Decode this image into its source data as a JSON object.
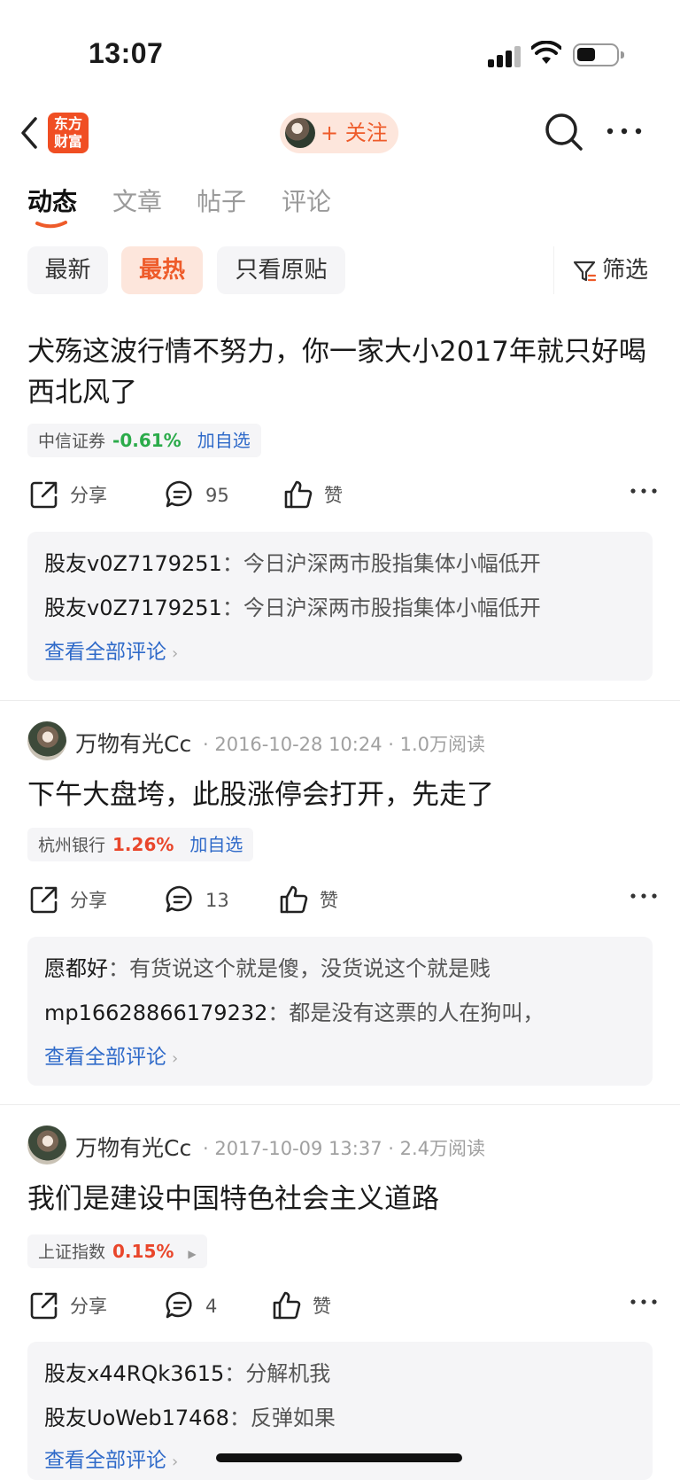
{
  "status_bar": {
    "time": "13:07"
  },
  "nav": {
    "logo_line1": "东方",
    "logo_line2": "财富",
    "follow_label": "+ 关注"
  },
  "tabs": [
    {
      "label": "动态",
      "active": true
    },
    {
      "label": "文章",
      "active": false
    },
    {
      "label": "帖子",
      "active": false
    },
    {
      "label": "评论",
      "active": false
    }
  ],
  "filters": {
    "chips": [
      {
        "label": "最新",
        "active": false
      },
      {
        "label": "最热",
        "active": true
      },
      {
        "label": "只看原贴",
        "active": false
      }
    ],
    "filter_label": "筛选"
  },
  "colors": {
    "accent": "#ee5b2a",
    "link": "#2f6ac9",
    "down": "#2bab4a",
    "up": "#e9462b"
  },
  "posts": [
    {
      "author": "",
      "meta": "",
      "title": "犬殇这波行情不努力，你一家大小2017年就只好喝西北风了",
      "stock": {
        "name": "中信证券",
        "change": "-0.61%",
        "direction": "down",
        "action": "加自选"
      },
      "share_label": "分享",
      "comment_count": "95",
      "like_label": "赞",
      "comments": [
        {
          "user": "股友v0Z7179251",
          "sep": "：",
          "text": "今日沪深两市股指集体小幅低开"
        },
        {
          "user": "股友v0Z7179251",
          "sep": "：",
          "text": "今日沪深两市股指集体小幅低开"
        }
      ],
      "view_all": "查看全部评论"
    },
    {
      "author": "万物有光Cc",
      "meta": "· 2016-10-28 10:24 · 1.0万阅读",
      "title": "下午大盘垮，此股涨停会打开，先走了",
      "stock": {
        "name": "杭州银行",
        "change": "1.26%",
        "direction": "up",
        "action": "加自选"
      },
      "share_label": "分享",
      "comment_count": "13",
      "like_label": "赞",
      "comments": [
        {
          "user": "愿都好",
          "sep": "：",
          "text": "有货说这个就是傻，没货说这个就是贱"
        },
        {
          "user": "mp16628866179232",
          "sep": "：",
          "text": "都是没有这票的人在狗叫，"
        }
      ],
      "view_all": "查看全部评论"
    },
    {
      "author": "万物有光Cc",
      "meta": "· 2017-10-09 13:37 · 2.4万阅读",
      "title": "我们是建设中国特色社会主义道路",
      "stock": {
        "name": "上证指数",
        "change": "0.15%",
        "direction": "up",
        "action": ""
      },
      "share_label": "分享",
      "comment_count": "4",
      "like_label": "赞",
      "comments": [
        {
          "user": "股友x44RQk3615",
          "sep": "：",
          "text": "分解机我"
        },
        {
          "user": "股友UoWeb17468",
          "sep": "：",
          "text": "反弹如果"
        }
      ],
      "view_all": "查看全部评论"
    }
  ]
}
